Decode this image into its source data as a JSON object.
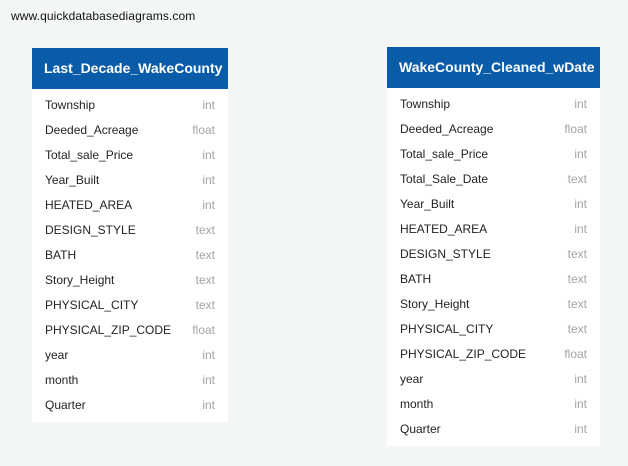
{
  "watermark": "www.quickdatabasediagrams.com",
  "colors": {
    "header_bg": "#0b5ca8",
    "header_text": "#ffffff",
    "canvas_bg": "#f4f6f5",
    "field_type_text": "#a3a3a3"
  },
  "tables": [
    {
      "name": "Last_Decade_WakeCounty",
      "fields": [
        {
          "name": "Township",
          "type": "int"
        },
        {
          "name": "Deeded_Acreage",
          "type": "float"
        },
        {
          "name": "Total_sale_Price",
          "type": "int"
        },
        {
          "name": "Year_Built",
          "type": "int"
        },
        {
          "name": "HEATED_AREA",
          "type": "int"
        },
        {
          "name": "DESIGN_STYLE",
          "type": "text"
        },
        {
          "name": "BATH",
          "type": "text"
        },
        {
          "name": "Story_Height",
          "type": "text"
        },
        {
          "name": "PHYSICAL_CITY",
          "type": "text"
        },
        {
          "name": "PHYSICAL_ZIP_CODE",
          "type": "float"
        },
        {
          "name": "year",
          "type": "int"
        },
        {
          "name": "month",
          "type": "int"
        },
        {
          "name": "Quarter",
          "type": "int"
        }
      ]
    },
    {
      "name": "WakeCounty_Cleaned_wDate",
      "fields": [
        {
          "name": "Township",
          "type": "int"
        },
        {
          "name": "Deeded_Acreage",
          "type": "float"
        },
        {
          "name": "Total_sale_Price",
          "type": "int"
        },
        {
          "name": "Total_Sale_Date",
          "type": "text"
        },
        {
          "name": "Year_Built",
          "type": "int"
        },
        {
          "name": "HEATED_AREA",
          "type": "int"
        },
        {
          "name": "DESIGN_STYLE",
          "type": "text"
        },
        {
          "name": "BATH",
          "type": "text"
        },
        {
          "name": "Story_Height",
          "type": "text"
        },
        {
          "name": "PHYSICAL_CITY",
          "type": "text"
        },
        {
          "name": "PHYSICAL_ZIP_CODE",
          "type": "float"
        },
        {
          "name": "year",
          "type": "int"
        },
        {
          "name": "month",
          "type": "int"
        },
        {
          "name": "Quarter",
          "type": "int"
        }
      ]
    }
  ]
}
